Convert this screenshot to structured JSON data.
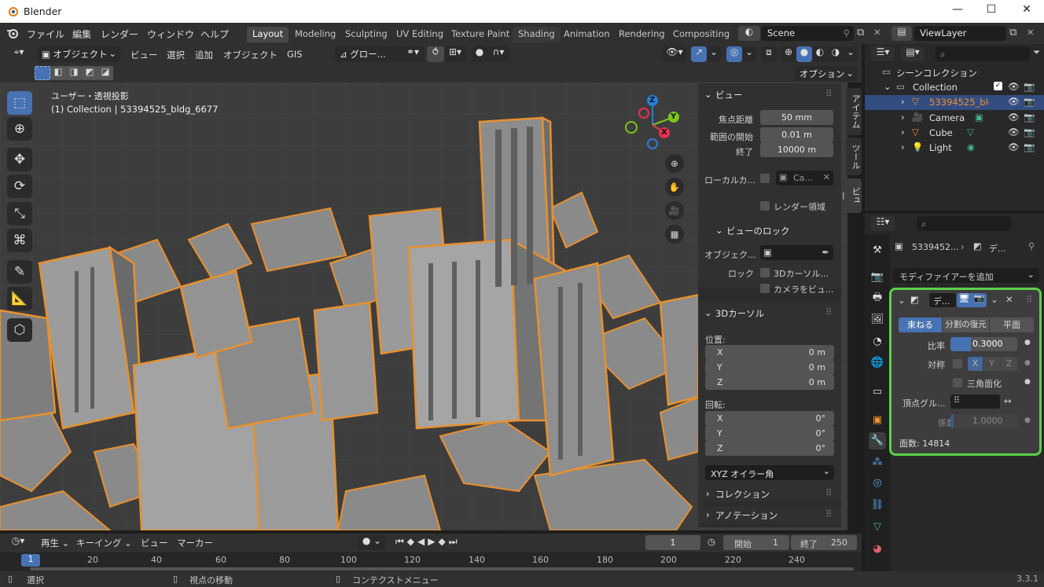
{
  "window": {
    "title": "Blender",
    "minimize": "—",
    "maximize": "☐",
    "close": "✕"
  },
  "menu": {
    "items": [
      "ファイル",
      "編集",
      "レンダー",
      "ウィンドウ",
      "ヘルプ"
    ]
  },
  "workspaces": [
    "Layout",
    "Modeling",
    "Sculpting",
    "UV Editing",
    "Texture Paint",
    "Shading",
    "Animation",
    "Rendering",
    "Compositing"
  ],
  "scene": {
    "name": "Scene",
    "viewlayer": "ViewLayer"
  },
  "viewport_header": {
    "mode": "オブジェクト",
    "menus": [
      "ビュー",
      "選択",
      "追加",
      "オブジェクト",
      "GIS"
    ],
    "transform": "グロー...",
    "options": "オプション"
  },
  "viewport": {
    "view_label": "ユーザー・透視投影",
    "collection_label": "(1) Collection | 53394525_bldg_6677",
    "gizmo": {
      "z": "Z",
      "y": "Y",
      "x": "X"
    }
  },
  "tabs": {
    "item": "アイテム",
    "tool": "ツール",
    "view": "ビュー"
  },
  "npanel": {
    "view_header": "ビュー",
    "focal_label": "焦点距離",
    "focal_value": "50 mm",
    "clip_start_label": "範囲の開始",
    "clip_start_value": "0.01 m",
    "clip_end_label": "終了",
    "clip_end_value": "10000 m",
    "local_camera_label": "ローカルカ...",
    "local_camera_value": "Ca...",
    "render_region": "レンダー領域",
    "view_lock_header": "ビューのロック",
    "lock_object_label": "オブジェク...",
    "lock_label": "ロック",
    "lock_cursor": "3Dカーソル...",
    "lock_camera": "カメラをビュ...",
    "cursor_header": "3Dカーソル",
    "location_label": "位置:",
    "loc": [
      {
        "k": "X",
        "v": "0 m"
      },
      {
        "k": "Y",
        "v": "0 m"
      },
      {
        "k": "Z",
        "v": "0 m"
      }
    ],
    "rotation_label": "回転:",
    "rot": [
      {
        "k": "X",
        "v": "0°"
      },
      {
        "k": "Y",
        "v": "0°"
      },
      {
        "k": "Z",
        "v": "0°"
      }
    ],
    "rotation_mode": "XYZ オイラー角",
    "collection_header": "コレクション",
    "annotation_header": "アノテーション"
  },
  "outliner": {
    "scene_collection": "シーンコレクション",
    "items": [
      {
        "name": "Collection",
        "indent": 1
      },
      {
        "name": "53394525_bldg",
        "indent": 2,
        "selected": true
      },
      {
        "name": "Camera",
        "indent": 2
      },
      {
        "name": "Cube",
        "indent": 2
      },
      {
        "name": "Light",
        "indent": 2
      }
    ]
  },
  "properties": {
    "breadcrumb_obj": "5339452...",
    "breadcrumb_mod": "デ...",
    "add_modifier": "モディファイアーを追加",
    "modifier": {
      "name": "デ...",
      "tabs": [
        "束ねる",
        "分割の復元",
        "平面"
      ],
      "ratio_label": "比率",
      "ratio_value": "0.3000",
      "ratio_fraction": 0.3,
      "sym_label": "対称",
      "sym_axes": [
        "X",
        "Y",
        "Z"
      ],
      "triangulate": "三角面化",
      "vgroup_label": "頂点グル...",
      "factor_label": "係数",
      "factor_value": "1.0000",
      "face_count": "面数: 14814"
    }
  },
  "timeline": {
    "menus": [
      "再生",
      "キーイング",
      "ビュー",
      "マーカー"
    ],
    "current_frame": "1",
    "start_label": "開始",
    "start": "1",
    "end_label": "終了",
    "end": "250",
    "ticks": [
      "20",
      "40",
      "60",
      "80",
      "100",
      "120",
      "140",
      "160",
      "180",
      "200",
      "220",
      "240"
    ],
    "playhead": "1"
  },
  "status": {
    "select": "選択",
    "rotate": "視点の移動",
    "context": "コンテクストメニュー",
    "version": "3.3.1"
  },
  "colors": {
    "accent": "#4772b3",
    "selection_outline": "#f0902c",
    "highlight": "#5cd04a"
  }
}
